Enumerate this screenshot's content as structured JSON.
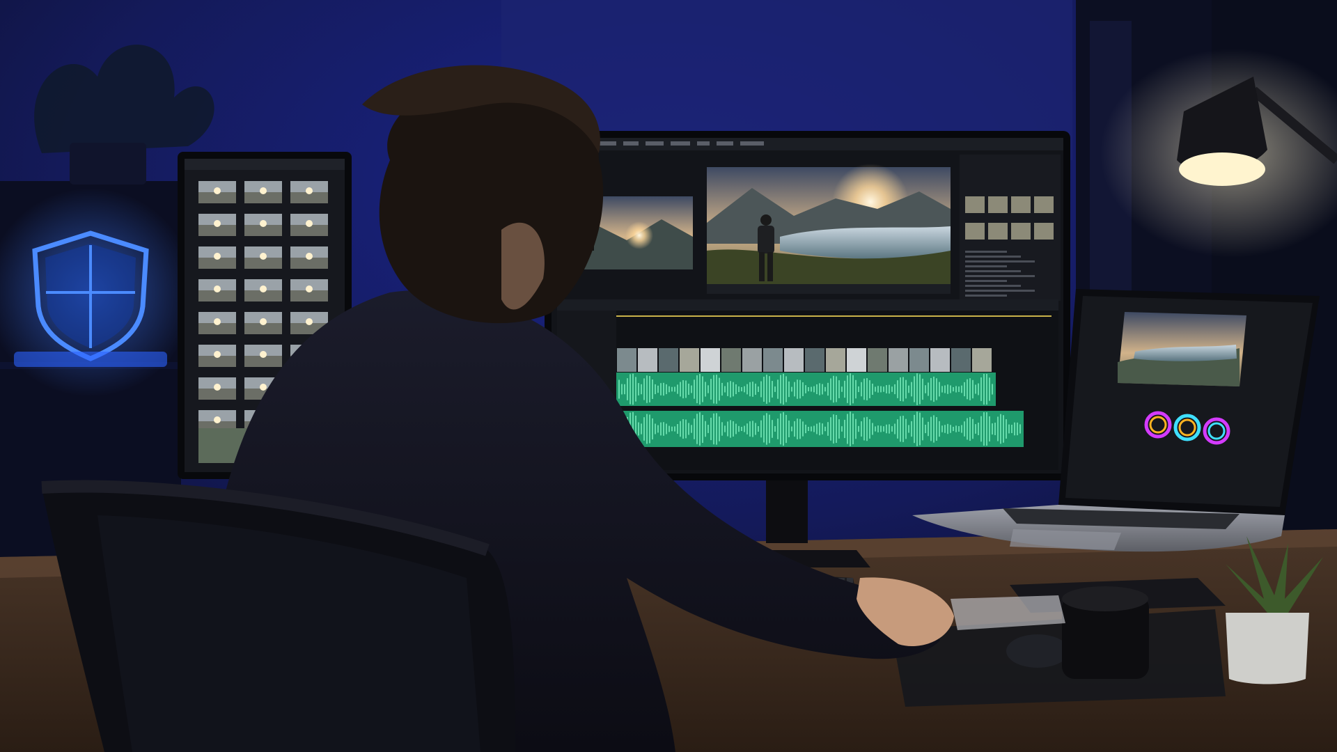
{
  "scene": {
    "description_visible_text": "",
    "colors": {
      "room_bg": "#0d1235",
      "wall_glow": "#1f2a9a",
      "shield_blue": "#3f7bff",
      "desk_wood": "#6b4a32",
      "lamp_light": "#fff4cf",
      "timeline_green": "#2fbf86",
      "screen_dark": "#15171d",
      "color_wheel_magenta": "#d43bff",
      "color_wheel_yellow": "#ffb321",
      "color_wheel_cyan": "#3fe0ff"
    },
    "icons": {
      "shield": "shield-icon",
      "lamp": "desk-lamp-icon",
      "plant": "potted-plant-icon",
      "mug": "coffee-mug-icon",
      "mouse": "mouse-icon",
      "keyboard": "keyboard-icon",
      "laptop": "laptop-icon",
      "chair": "office-chair-icon"
    }
  }
}
